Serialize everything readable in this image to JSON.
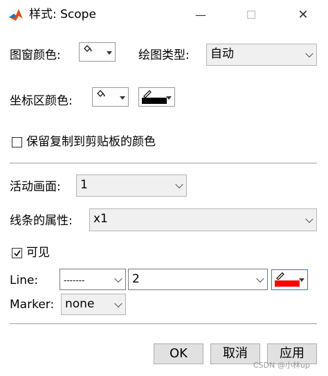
{
  "window": {
    "title": "样式: Scope",
    "minimize_symbol": "—",
    "maximize_symbol": "☐",
    "close_symbol": "✕"
  },
  "figure_color": {
    "label": "图窗颜色:"
  },
  "plot_type": {
    "label": "绘图类型:",
    "value": "自动"
  },
  "axes_color": {
    "label": "坐标区颜色:"
  },
  "preserve_colors": {
    "label": "保留复制到剪贴板的颜色",
    "checked": false
  },
  "active_display": {
    "label": "活动画面:",
    "value": "1"
  },
  "line_properties": {
    "label": "线条的属性:",
    "value": "x1"
  },
  "visible": {
    "label": "可见",
    "checked": true
  },
  "line": {
    "label": "Line:",
    "style_value": "-------",
    "width_value": "2"
  },
  "marker": {
    "label": "Marker:",
    "value": "none"
  },
  "buttons": {
    "ok": "OK",
    "cancel": "取消",
    "apply": "应用"
  },
  "watermark": "CSDN @小林up",
  "colors": {
    "figure": "#ffffff",
    "axes_background": "#ffffff",
    "axes_foreground": "#000000",
    "line": "#ff0000",
    "matlab_icon": "#d95319"
  }
}
